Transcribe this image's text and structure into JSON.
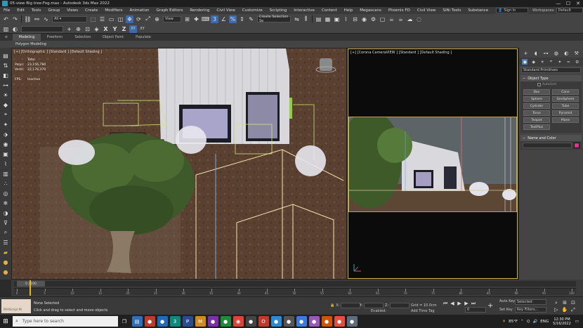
{
  "window": {
    "title": "05-view Big tree-Fog.max - Autodesk 3ds Max 2022",
    "minimize": "—",
    "maximize": "☐",
    "close": "✕"
  },
  "menu": {
    "items": [
      "File",
      "Edit",
      "Tools",
      "Group",
      "Views",
      "Create",
      "Modifiers",
      "Animation",
      "Graph Editors",
      "Rendering",
      "Civil View",
      "Customize",
      "Scripting",
      "Interactive",
      "Content",
      "Help",
      "Megascans",
      "Phoenix FD",
      "Civil View",
      "SiNi Tools",
      "Substance"
    ],
    "signin": "Sign In",
    "workspace_label": "Workspaces:",
    "workspace_value": "Default"
  },
  "toolbar": {
    "layer_value": "",
    "view_dropdown": "View",
    "selection_set": "Create Selection Se",
    "axis_x": "X",
    "axis_y": "Y",
    "axis_z": "Z",
    "axis_xy": "XY",
    "axis_xy2": "XY"
  },
  "ribbon": {
    "tabs": [
      "Modeling",
      "Freeform",
      "Selection",
      "Object Paint",
      "Populate"
    ],
    "sub_label": "Polygon Modeling"
  },
  "viewport_main": {
    "label": "[+] [Orthographic ] [Standard ] [Default Shading ]",
    "stats": {
      "header": "Total",
      "polys_label": "Polys:",
      "polys_value": "23,156,780",
      "verts_label": "Verts:",
      "verts_value": "22,176,370",
      "fps_label": "FPS:",
      "fps_value": "Inactive"
    }
  },
  "viewport_right": {
    "label": "[+] [Corona CameraVIEW ] [Standard ] [Default Shading ]"
  },
  "command_panel": {
    "category_dropdown": "Standard Primitives",
    "object_type_title": "Object Type",
    "autogrid_label": "AutoGrid",
    "objects": [
      "Box",
      "Cone",
      "Sphere",
      "GeoSphere",
      "Cylinder",
      "Tube",
      "Torus",
      "Pyramid",
      "Teapot",
      "Plane",
      "TextPlus"
    ],
    "name_color_title": "Name and Color",
    "color": "#d23a8e"
  },
  "timeline": {
    "slider_label": "0 / 100",
    "ticks": [
      "0",
      "5",
      "10",
      "15",
      "20",
      "25",
      "30",
      "35",
      "40",
      "45",
      "50",
      "55",
      "60",
      "65",
      "70",
      "75",
      "80",
      "85",
      "90",
      "95",
      "100"
    ],
    "current_fraction": 0.0
  },
  "status": {
    "maxscript_placeholder": "MAXScript Mi",
    "selection_text": "None Selected",
    "prompt_text": "Click and drag to select and move objects",
    "x_label": "X:",
    "y_label": "Y:",
    "z_label": "Z:",
    "grid": "Grid = 10.0cm",
    "enabled_label": "Enabled:",
    "add_time_tag": "Add Time Tag",
    "auto_key": "Auto Key",
    "set_key": "Set Key",
    "selected": "Selected",
    "key_filters": "Key Filters...",
    "frame_value": "0"
  },
  "taskbar": {
    "search_placeholder": "Type here to search",
    "weather": "85°F",
    "language": "ENG",
    "time": "12:30 PM",
    "date": "5/16/2022"
  }
}
